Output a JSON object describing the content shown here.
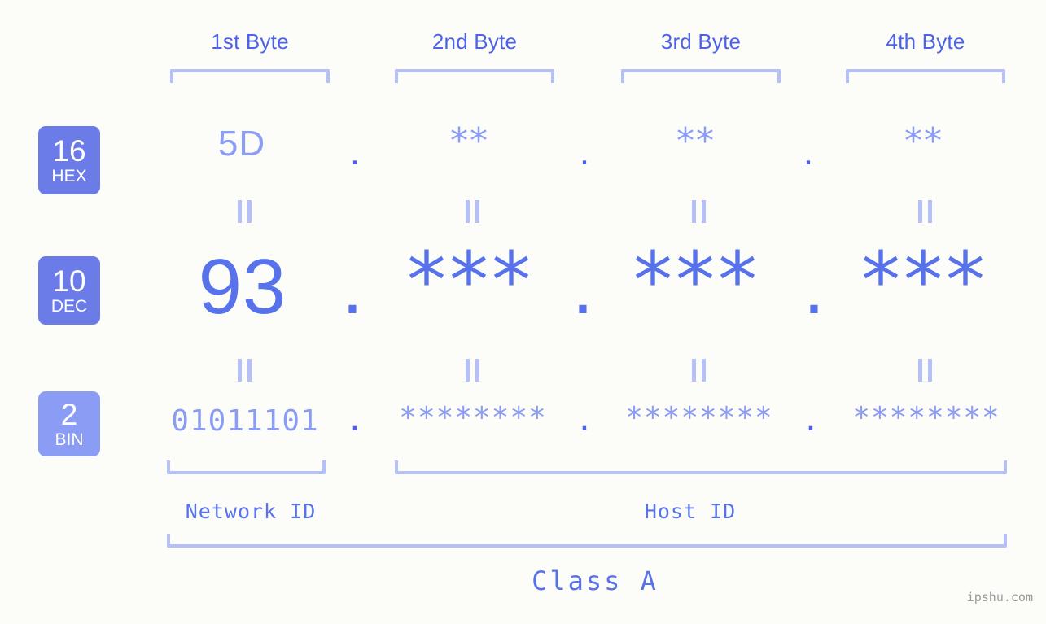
{
  "background_color": "#fcfdf9",
  "accent_strong": "#5872ec",
  "accent_mid": "#8b9cf4",
  "accent_light": "#b6c0f8",
  "badge_fill": "#6b7ce8",
  "badge_fill_light": "#8b9cf4",
  "byte_headers": [
    {
      "label": "1st Byte"
    },
    {
      "label": "2nd Byte"
    },
    {
      "label": "3rd Byte"
    },
    {
      "label": "4th Byte"
    }
  ],
  "radix_badges": [
    {
      "number": "16",
      "name": "HEX"
    },
    {
      "number": "10",
      "name": "DEC"
    },
    {
      "number": "2",
      "name": "BIN"
    }
  ],
  "rows": {
    "hex": {
      "radix": "16",
      "radix_name": "HEX",
      "values": [
        "5D",
        "**",
        "**",
        "**"
      ],
      "separator": "."
    },
    "dec": {
      "radix": "10",
      "radix_name": "DEC",
      "values": [
        "93",
        "***",
        "***",
        "***"
      ],
      "separator": "."
    },
    "bin": {
      "radix": "2",
      "radix_name": "BIN",
      "values": [
        "01011101",
        "********",
        "********",
        "********"
      ],
      "separator": "."
    }
  },
  "equivalence_mark": "||",
  "sections": [
    {
      "label": "Network ID"
    },
    {
      "label": "Host ID"
    }
  ],
  "class_label": "Class A",
  "watermark": "ipshu.com"
}
